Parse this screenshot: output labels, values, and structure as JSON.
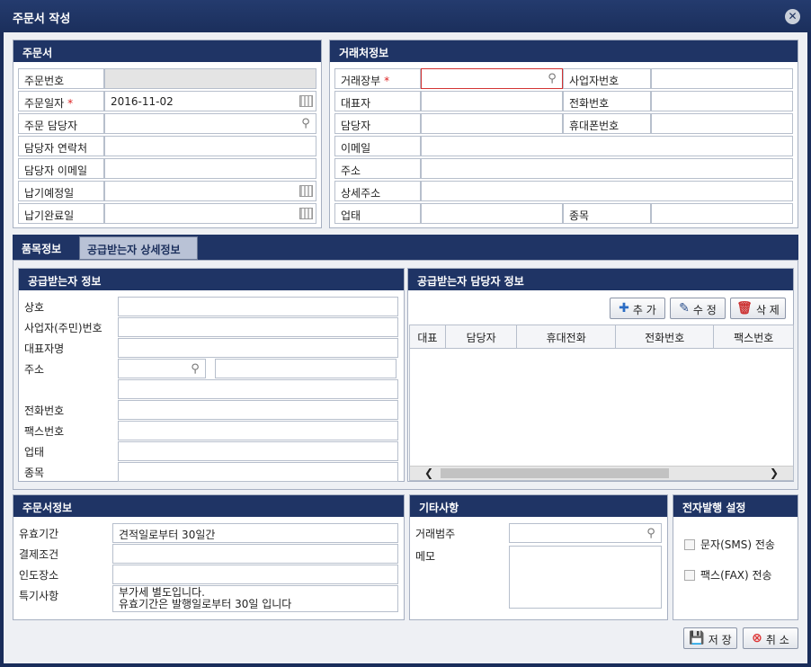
{
  "window": {
    "title": "주문서 작성"
  },
  "order": {
    "header": "주문서",
    "rows": [
      {
        "label": "주문번호",
        "value": "",
        "required": false
      },
      {
        "label": "주문일자",
        "value": "2016-11-02",
        "required": true
      },
      {
        "label": "주문 담당자",
        "value": "",
        "required": false
      },
      {
        "label": "담당자 연락처",
        "value": "",
        "required": false
      },
      {
        "label": "담당자 이메일",
        "value": "",
        "required": false
      },
      {
        "label": "납기예정일",
        "value": "",
        "required": false
      },
      {
        "label": "납기완료일",
        "value": "",
        "required": false
      }
    ],
    "required_mark": "*"
  },
  "partner": {
    "header": "거래처정보",
    "labels": {
      "ledger": "거래장부",
      "bizno": "사업자번호",
      "ceo": "대표자",
      "phone": "전화번호",
      "manager": "담당자",
      "mobile": "휴대폰번호",
      "email": "이메일",
      "address": "주소",
      "address_detail": "상세주소",
      "biztype": "업태",
      "bizitem": "종목"
    }
  },
  "tabs": [
    {
      "label": "품목정보"
    },
    {
      "label": "공급받는자 상세정보"
    }
  ],
  "receiver": {
    "header": "공급받는자 정보",
    "labels": [
      "상호",
      "사업자(주민)번호",
      "대표자명",
      "주소",
      "",
      "전화번호",
      "팩스번호",
      "업태",
      "종목"
    ]
  },
  "contacts": {
    "header": "공급받는자 담당자 정보",
    "buttons": {
      "add": "추 가",
      "edit": "수 정",
      "delete": "삭 제"
    },
    "columns": [
      "대표",
      "담당자",
      "휴대전화",
      "전화번호",
      "팩스번호"
    ]
  },
  "orderinfo": {
    "header": "주문서정보",
    "rows": [
      {
        "label": "유효기간",
        "value": "견적일로부터 30일간"
      },
      {
        "label": "결제조건",
        "value": ""
      },
      {
        "label": "인도장소",
        "value": ""
      },
      {
        "label": "특기사항",
        "value": "부가세 별도입니다.\n유효기간은 발행일로부터 30일 입니다"
      }
    ]
  },
  "etc": {
    "header": "기타사항",
    "category_label": "거래범주",
    "memo_label": "메모"
  },
  "edoc": {
    "header": "전자발행 설정",
    "sms": "문자(SMS) 전송",
    "fax": "팩스(FAX) 전송"
  },
  "footer": {
    "save": "저 장",
    "cancel": "취 소"
  }
}
